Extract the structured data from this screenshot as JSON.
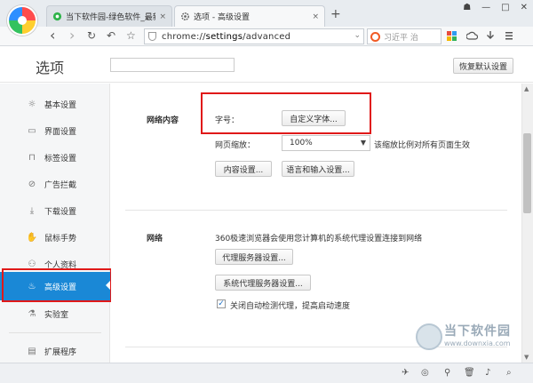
{
  "tabs": [
    {
      "label": "当下软件园-绿色软件_最新绿",
      "close": "×"
    },
    {
      "label": "选项 - 高级设置",
      "close": "×"
    }
  ],
  "new_tab": "+",
  "window_controls": [
    "☗",
    "—",
    "□",
    "✕"
  ],
  "nav": {
    "back": "‹",
    "forward": "›",
    "reload": "↻",
    "undo": "↶",
    "star": "☆",
    "url_prefix": "chrome://",
    "url_main": "settings",
    "url_suffix": "/advanced",
    "url_dropdown": "⌄",
    "search_text": "习近平 治"
  },
  "settings": {
    "title": "选项",
    "reset_label": "恢复默认设置"
  },
  "sidebar": {
    "items": [
      {
        "label": "基本设置",
        "icon": "☼"
      },
      {
        "label": "界面设置",
        "icon": "▭"
      },
      {
        "label": "标签设置",
        "icon": "⊓"
      },
      {
        "label": "广告拦截",
        "icon": "⊘"
      },
      {
        "label": "下载设置",
        "icon": "⤓"
      },
      {
        "label": "鼠标手势",
        "icon": "✋"
      },
      {
        "label": "个人资料",
        "icon": "⚇"
      },
      {
        "label": "高级设置",
        "icon": "♨"
      },
      {
        "label": "实验室",
        "icon": "⚗"
      },
      {
        "label": "扩展程序",
        "icon": "▤"
      }
    ]
  },
  "web_content": {
    "title": "网络内容",
    "font_label": "字号：",
    "custom_font_btn": "自定义字体...",
    "zoom_label": "网页缩放：",
    "zoom_value": "100%",
    "zoom_note": "该缩放比例对所有页面生效",
    "content_settings_btn": "内容设置...",
    "language_btn": "语言和输入设置..."
  },
  "network": {
    "title": "网络",
    "desc": "360极速浏览器会使用您计算机的系统代理设置连接到网络",
    "proxy_btn": "代理服务器设置...",
    "system_proxy_btn": "系统代理服务器设置...",
    "auto_detect_label": "关闭自动检测代理，提高启动速度"
  },
  "watermark": {
    "text": "当下软件园",
    "url": "www.downxia.com"
  }
}
